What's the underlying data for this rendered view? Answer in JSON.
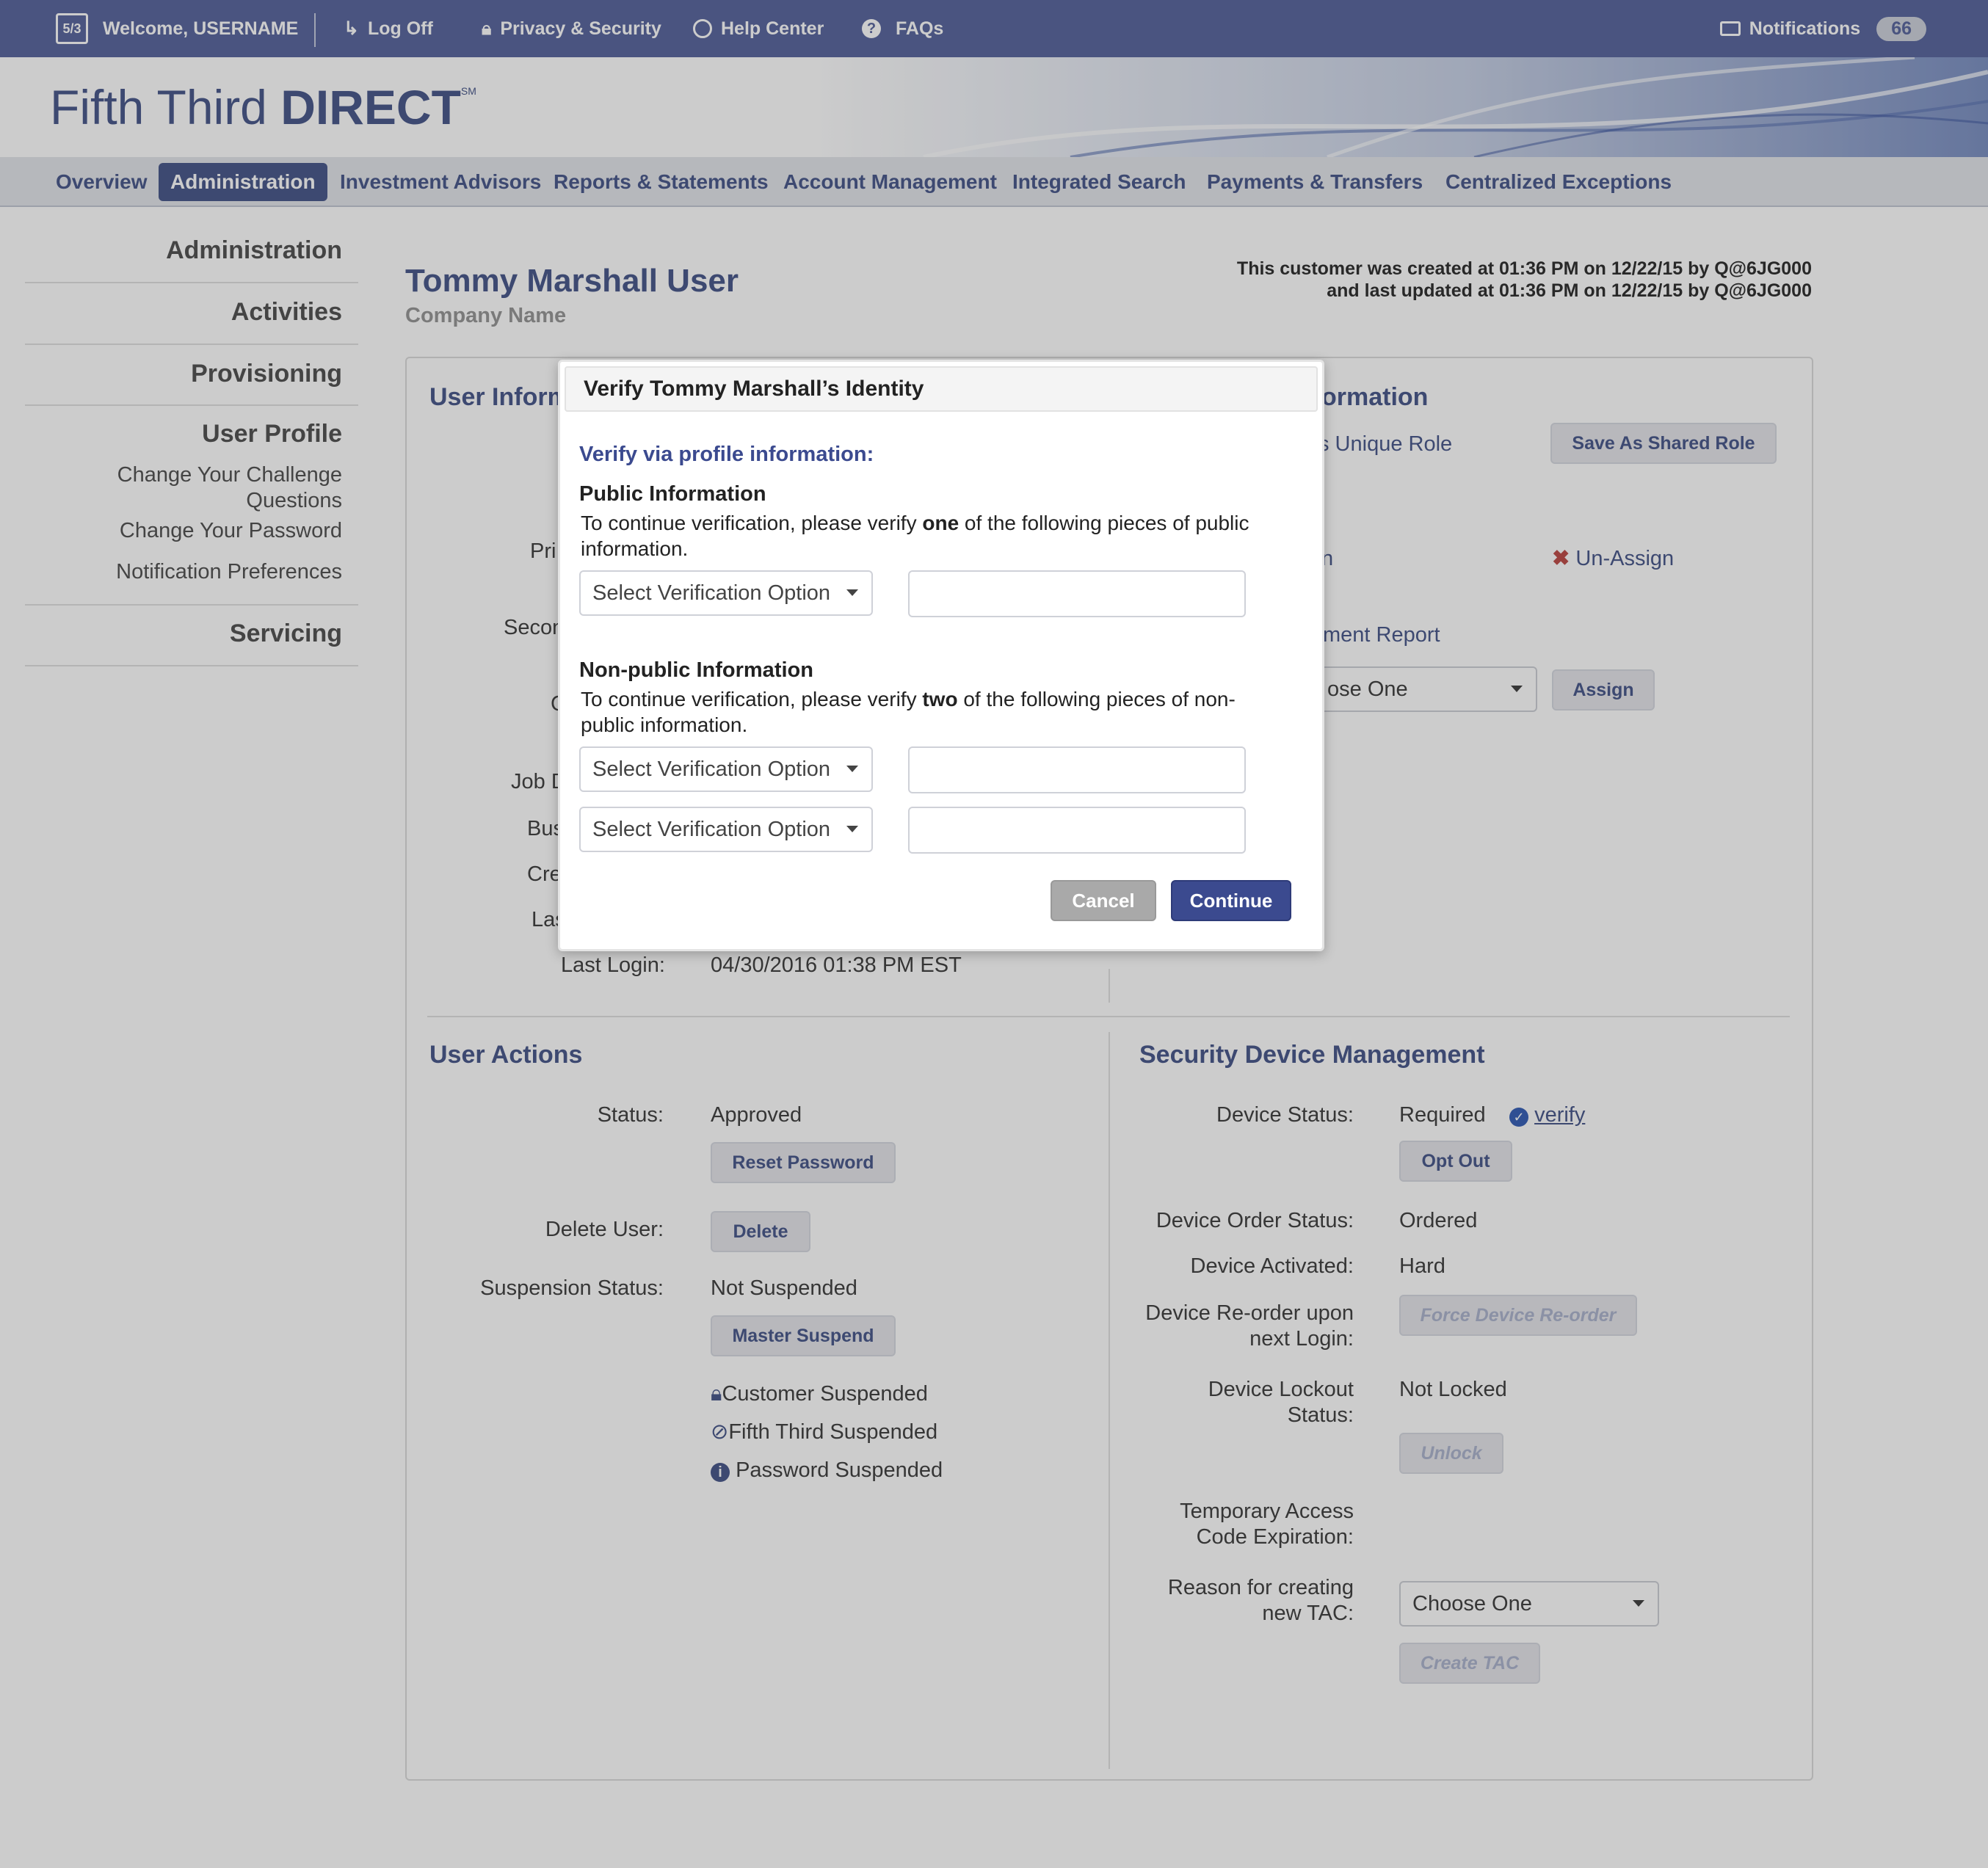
{
  "topbar": {
    "welcome": "Welcome, USERNAME",
    "logoff": "Log Off",
    "privacy": "Privacy & Security",
    "help": "Help Center",
    "faqs": "FAQs",
    "notifications": "Notifications",
    "notifications_count": "66"
  },
  "brand": {
    "logo_light": "Fifth Third ",
    "logo_bold": "DIRECT",
    "logo_mark": "SM"
  },
  "nav": [
    "Overview",
    "Administration",
    "Investment Advisors",
    "Reports & Statements",
    "Account Management",
    "Integrated Search",
    "Payments & Transfers",
    "Centralized Exceptions"
  ],
  "sidebar": {
    "administration": "Administration",
    "activities": "Activities",
    "provisioning": "Provisioning",
    "user_profile": "User Profile",
    "change_questions_1": "Change Your Challenge",
    "change_questions_2": "Questions",
    "change_password": "Change Your Password",
    "notification_prefs": "Notification Preferences",
    "servicing": "Servicing"
  },
  "header": {
    "user_name": "Tommy Marshall User",
    "company": "Company Name",
    "created": "This customer was created at 01:36 PM on 12/22/15 by Q@6JG000",
    "updated": "and last updated at 01:36 PM on 12/22/15 by Q@6JG000"
  },
  "user_info": {
    "title": "User Inform",
    "label_pri": "Pri",
    "label_secon": "Secon",
    "label_c": "C",
    "label_job": "Job D",
    "label_bus": "Bus",
    "label_cre": "Cre",
    "label_las": "Las",
    "last_login_label": "Last Login:",
    "last_login_value": "04/30/2016 01:38 PM EST"
  },
  "role_info": {
    "title": "ormation",
    "unique_role": "s Unique Role",
    "save_shared": "Save As Shared Role",
    "n_text": "n",
    "unassign": "Un-Assign",
    "report_link": "ment Report",
    "choose_partial": "ose One",
    "assign": "Assign"
  },
  "user_actions": {
    "title": "User Actions",
    "status_label": "Status:",
    "status_value": "Approved",
    "reset_password": "Reset Password",
    "delete_label": "Delete User:",
    "delete_button": "Delete",
    "suspension_label": "Suspension Status:",
    "suspension_value": "Not Suspended",
    "master_suspend": "Master Suspend",
    "customer_suspended": "Customer Suspended",
    "fifth_third_suspended": "Fifth Third Suspended",
    "password_suspended": "Password Suspended"
  },
  "security": {
    "title": "Security Device Management",
    "device_status_label": "Device Status:",
    "device_status_value": "Required",
    "verify": "verify",
    "opt_out": "Opt Out",
    "order_status_label": "Device Order Status:",
    "order_status_value": "Ordered",
    "activated_label": "Device Activated:",
    "activated_value": "Hard",
    "reorder_label_1": "Device Re-order upon",
    "reorder_label_2": "next Login:",
    "force_reorder": "Force Device Re-order",
    "lockout_label_1": "Device Lockout",
    "lockout_label_2": "Status:",
    "lockout_value": "Not Locked",
    "unlock": "Unlock",
    "tac_exp_1": "Temporary Access",
    "tac_exp_2": "Code Expiration:",
    "reason_1": "Reason for creating",
    "reason_2": "new TAC:",
    "reason_select": "Choose One",
    "create_tac": "Create TAC"
  },
  "dialog": {
    "title": "Verify Tommy Marshall’s Identity",
    "subtitle": "Verify via profile information:",
    "public_h": "Public Information",
    "public_t1": "To continue verification, please verify ",
    "public_bold": "one",
    "public_t2": " of the following pieces of public information.",
    "nonpublic_h": "Non-public Information",
    "nonpublic_t1": "To continue verification, please verify ",
    "nonpublic_bold": "two",
    "nonpublic_t2": " of the following pieces of non-public information.",
    "select_option": "Select Verification Option",
    "cancel": "Cancel",
    "continue": "Continue"
  },
  "colors": {
    "brand": "#4d5c8e",
    "topbar": "#5d6aa0",
    "continue": "#3b4a8f",
    "cancel": "#a9a9a9",
    "unassign_x": "#c0504d"
  }
}
